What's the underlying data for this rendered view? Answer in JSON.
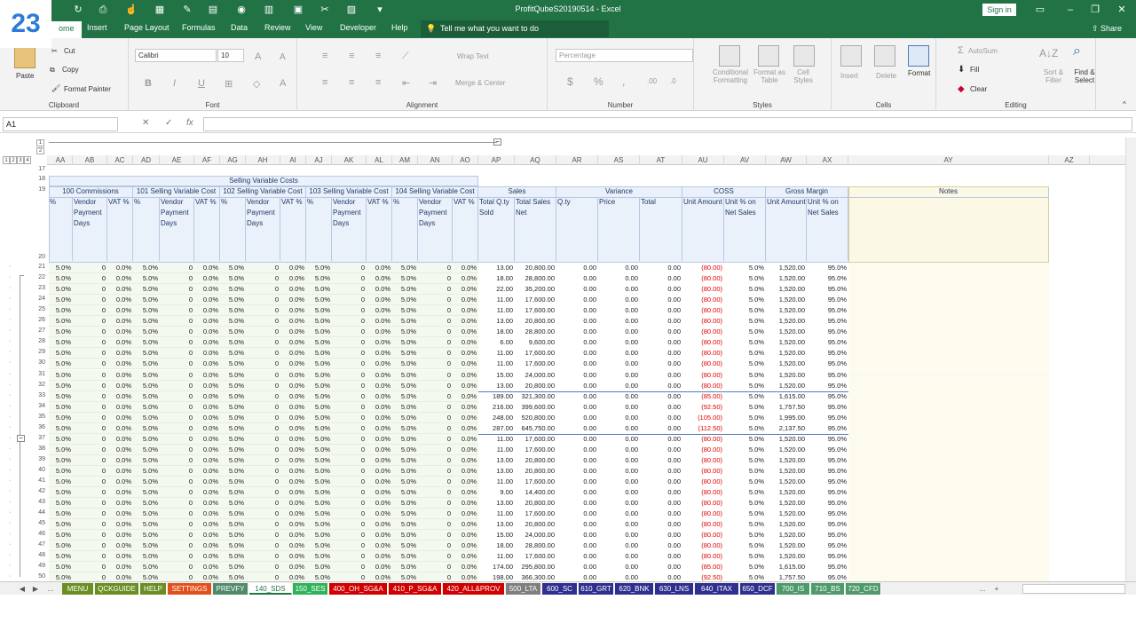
{
  "badge": "23",
  "window": {
    "title": "ProfitQubeS20190514  -  Excel",
    "signin": "Sign in",
    "share": "Share"
  },
  "ribbon_tabs": [
    "ome",
    "Insert",
    "Page Layout",
    "Formulas",
    "Data",
    "Review",
    "View",
    "Developer",
    "Help"
  ],
  "tell_me": "Tell me what you want to do",
  "clipboard": {
    "paste": "Paste",
    "cut": "Cut",
    "copy": "Copy",
    "format_painter": "Format Painter",
    "label": "Clipboard"
  },
  "font": {
    "name": "Calibri",
    "size": "10",
    "bold": "B",
    "italic": "I",
    "underline": "U",
    "label": "Font"
  },
  "alignment": {
    "wrap": "Wrap Text",
    "merge": "Merge & Center",
    "label": "Alignment"
  },
  "number": {
    "format": "Percentage",
    "currency": "$",
    "percent": "%",
    "comma": ",",
    "label": "Number"
  },
  "styles": {
    "conditional": "Conditional Formatting",
    "format_table": "Format as Table",
    "cell_styles": "Cell Styles",
    "label": "Styles"
  },
  "cells": {
    "insert": "Insert",
    "delete": "Delete",
    "format": "Format",
    "label": "Cells"
  },
  "editing": {
    "autosum": "AutoSum",
    "fill": "Fill",
    "clear": "Clear",
    "sort": "Sort & Filter",
    "find": "Find & Select",
    "label": "Editing"
  },
  "formula_bar": {
    "name_box": "A1",
    "fx": "fx"
  },
  "outline_levels": [
    "1",
    "2",
    "3",
    "4"
  ],
  "outline_col_levels": [
    "1",
    "2"
  ],
  "columns": [
    "AA",
    "AB",
    "AC",
    "AD",
    "AE",
    "AF",
    "AG",
    "AH",
    "AI",
    "AJ",
    "AK",
    "AL",
    "AM",
    "AN",
    "AO",
    "AP",
    "AQ",
    "AR",
    "AS",
    "AT",
    "AU",
    "AV",
    "AW",
    "AX",
    "AY",
    "AZ"
  ],
  "header": {
    "svc": "Selling Variable Costs",
    "groups": [
      "100 Commissions",
      "101 Selling Variable Cost",
      "102 Selling Variable Cost",
      "103 Selling Variable Cost",
      "104 Selling Variable Cost",
      "Sales",
      "Variance",
      "COSS",
      "Gross Margin",
      "Notes"
    ],
    "sub": [
      "%",
      "Vendor Payment Days",
      "VAT %",
      "%",
      "Vendor Payment Days",
      "VAT %",
      "%",
      "Vendor Payment Days",
      "VAT %",
      "%",
      "Vendor Payment Days",
      "VAT %",
      "%",
      "Vendor Payment Days",
      "VAT %",
      "Total Q.ty Sold",
      "Total Sales Net",
      "Q.ty",
      "Price",
      "Total",
      "Unit Amount",
      "Unit % on Net Sales",
      "Unit Amount",
      "Unit % on Net Sales"
    ]
  },
  "rows": [
    {
      "n": "21",
      "qty": "13.00",
      "sales": "20,800.00",
      "coss": "(80.00)",
      "gm": "1,520.00"
    },
    {
      "n": "22",
      "qty": "18.00",
      "sales": "28,800.00",
      "coss": "(80.00)",
      "gm": "1,520.00"
    },
    {
      "n": "23",
      "qty": "22.00",
      "sales": "35,200.00",
      "coss": "(80.00)",
      "gm": "1,520.00"
    },
    {
      "n": "24",
      "qty": "11.00",
      "sales": "17,600.00",
      "coss": "(80.00)",
      "gm": "1,520.00"
    },
    {
      "n": "25",
      "qty": "11.00",
      "sales": "17,600.00",
      "coss": "(80.00)",
      "gm": "1,520.00"
    },
    {
      "n": "26",
      "qty": "13.00",
      "sales": "20,800.00",
      "coss": "(80.00)",
      "gm": "1,520.00"
    },
    {
      "n": "27",
      "qty": "18.00",
      "sales": "28,800.00",
      "coss": "(80.00)",
      "gm": "1,520.00"
    },
    {
      "n": "28",
      "qty": "6.00",
      "sales": "9,600.00",
      "coss": "(80.00)",
      "gm": "1,520.00"
    },
    {
      "n": "29",
      "qty": "11.00",
      "sales": "17,600.00",
      "coss": "(80.00)",
      "gm": "1,520.00"
    },
    {
      "n": "30",
      "qty": "11.00",
      "sales": "17,600.00",
      "coss": "(80.00)",
      "gm": "1,520.00"
    },
    {
      "n": "31",
      "qty": "15.00",
      "sales": "24,000.00",
      "coss": "(80.00)",
      "gm": "1,520.00"
    },
    {
      "n": "32",
      "qty": "13.00",
      "sales": "20,800.00",
      "coss": "(80.00)",
      "gm": "1,520.00"
    },
    {
      "n": "33",
      "qty": "189.00",
      "sales": "321,300.00",
      "coss": "(85.00)",
      "gm": "1,615.00"
    },
    {
      "n": "34",
      "qty": "216.00",
      "sales": "399,600.00",
      "coss": "(92.50)",
      "gm": "1,757.50"
    },
    {
      "n": "35",
      "qty": "248.00",
      "sales": "520,800.00",
      "coss": "(105.00)",
      "gm": "1,995.00"
    },
    {
      "n": "36",
      "qty": "287.00",
      "sales": "645,750.00",
      "coss": "(112.50)",
      "gm": "2,137.50"
    },
    {
      "n": "37",
      "qty": "11.00",
      "sales": "17,600.00",
      "coss": "(80.00)",
      "gm": "1,520.00"
    },
    {
      "n": "38",
      "qty": "11.00",
      "sales": "17,600.00",
      "coss": "(80.00)",
      "gm": "1,520.00"
    },
    {
      "n": "39",
      "qty": "13.00",
      "sales": "20,800.00",
      "coss": "(80.00)",
      "gm": "1,520.00"
    },
    {
      "n": "40",
      "qty": "13.00",
      "sales": "20,800.00",
      "coss": "(80.00)",
      "gm": "1,520.00"
    },
    {
      "n": "41",
      "qty": "11.00",
      "sales": "17,600.00",
      "coss": "(80.00)",
      "gm": "1,520.00"
    },
    {
      "n": "42",
      "qty": "9.00",
      "sales": "14,400.00",
      "coss": "(80.00)",
      "gm": "1,520.00"
    },
    {
      "n": "43",
      "qty": "13.00",
      "sales": "20,800.00",
      "coss": "(80.00)",
      "gm": "1,520.00"
    },
    {
      "n": "44",
      "qty": "11.00",
      "sales": "17,600.00",
      "coss": "(80.00)",
      "gm": "1,520.00"
    },
    {
      "n": "45",
      "qty": "13.00",
      "sales": "20,800.00",
      "coss": "(80.00)",
      "gm": "1,520.00"
    },
    {
      "n": "46",
      "qty": "15.00",
      "sales": "24,000.00",
      "coss": "(80.00)",
      "gm": "1,520.00"
    },
    {
      "n": "47",
      "qty": "18.00",
      "sales": "28,800.00",
      "coss": "(80.00)",
      "gm": "1,520.00"
    },
    {
      "n": "48",
      "qty": "11.00",
      "sales": "17,600.00",
      "coss": "(80.00)",
      "gm": "1,520.00"
    },
    {
      "n": "49",
      "qty": "174.00",
      "sales": "295,800.00",
      "coss": "(85.00)",
      "gm": "1,615.00"
    },
    {
      "n": "50",
      "qty": "198.00",
      "sales": "366,300.00",
      "coss": "(92.50)",
      "gm": "1,757.50"
    }
  ],
  "cell_constants": {
    "pct": "5.0%",
    "days": "0",
    "vat": "0.0%",
    "zero": "0.00",
    "coss_pct": "5.0%",
    "gm_pct": "95.0%"
  },
  "sheet_tabs": [
    {
      "label": "MENU",
      "color": "#6b8e23"
    },
    {
      "label": "QCKGUIDE",
      "color": "#6b8e23"
    },
    {
      "label": "HELP",
      "color": "#6b8e23"
    },
    {
      "label": "SETTINGS",
      "color": "#e2501b"
    },
    {
      "label": "PREVFY",
      "color": "#4f8a6b"
    },
    {
      "label": "140_SDS",
      "color": "#ffffff"
    },
    {
      "label": "150_SES",
      "color": "#2fb35a"
    },
    {
      "label": "400_OH_SG&A",
      "color": "#d00000"
    },
    {
      "label": "410_P_SG&A",
      "color": "#d00000"
    },
    {
      "label": "420_ALL&PROV",
      "color": "#d00000"
    },
    {
      "label": "500_LTA",
      "color": "#7f7f7f"
    },
    {
      "label": "600_SC",
      "color": "#2f2f8f"
    },
    {
      "label": "610_GRT",
      "color": "#2f2f8f"
    },
    {
      "label": "620_BNK",
      "color": "#2f2f8f"
    },
    {
      "label": "630_LNS",
      "color": "#2f2f8f"
    },
    {
      "label": "640_ITAX",
      "color": "#2f2f8f"
    },
    {
      "label": "650_DCF",
      "color": "#2f2f8f"
    },
    {
      "label": "700_IS",
      "color": "#4f9a6b"
    },
    {
      "label": "710_BS",
      "color": "#4f9a6b"
    },
    {
      "label": "720_CFD",
      "color": "#4f9a6b"
    }
  ],
  "sheet_nav": {
    "more": "...",
    "more_right": "...",
    "add": "+"
  }
}
